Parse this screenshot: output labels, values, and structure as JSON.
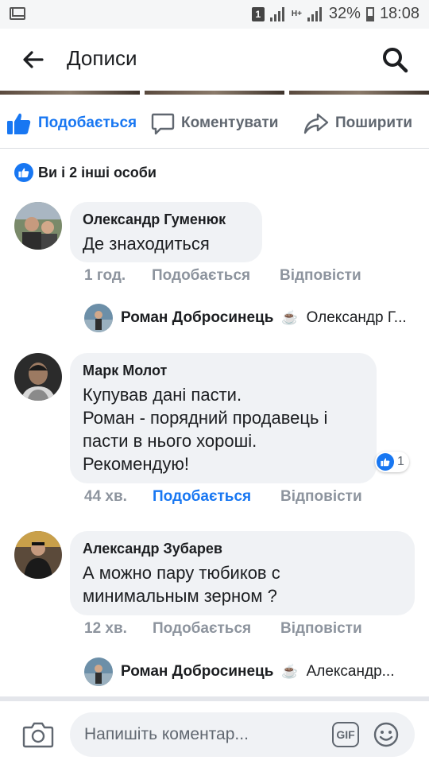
{
  "status_bar": {
    "sim_label": "1",
    "network": "H+",
    "battery": "32%",
    "time": "18:08"
  },
  "app_bar": {
    "title": "Дописи",
    "icons": [
      "back-arrow-icon",
      "search-icon"
    ]
  },
  "actions": {
    "like": "Подобається",
    "comment": "Коментувати",
    "share": "Поширити"
  },
  "reactions": {
    "summary": "Ви і 2 інші особи"
  },
  "comments": [
    {
      "author": "Олександр Гуменюк",
      "text": "Де знаходиться",
      "time": "1 год.",
      "like": "Подобається",
      "reply": "Відповісти",
      "reply_preview": {
        "author": "Роман Добросинець",
        "text": "Олександр Г..."
      }
    },
    {
      "author": "Марк Молот",
      "text_lines": [
        "Купував дані пасти.",
        "Роман - порядний продавець і",
        "пасти в нього хороші.",
        "Рекомендую!"
      ],
      "likes": "1",
      "time": "44 хв.",
      "like": "Подобається",
      "reply": "Відповісти"
    },
    {
      "author": "Александр Зубарев",
      "text_lines": [
        "А можно пару тюбиков с",
        "минимальным зерном ?"
      ],
      "time": "12 хв.",
      "like": "Подобається",
      "reply": "Відповісти",
      "reply_preview": {
        "author": "Роман Добросинець",
        "text": "Александр..."
      }
    }
  ],
  "composer": {
    "placeholder": "Напишіть коментар...",
    "gif_label": "GIF"
  },
  "colors": {
    "accent": "#1877f2",
    "bubble": "#f0f2f5",
    "muted": "#8d949e"
  }
}
